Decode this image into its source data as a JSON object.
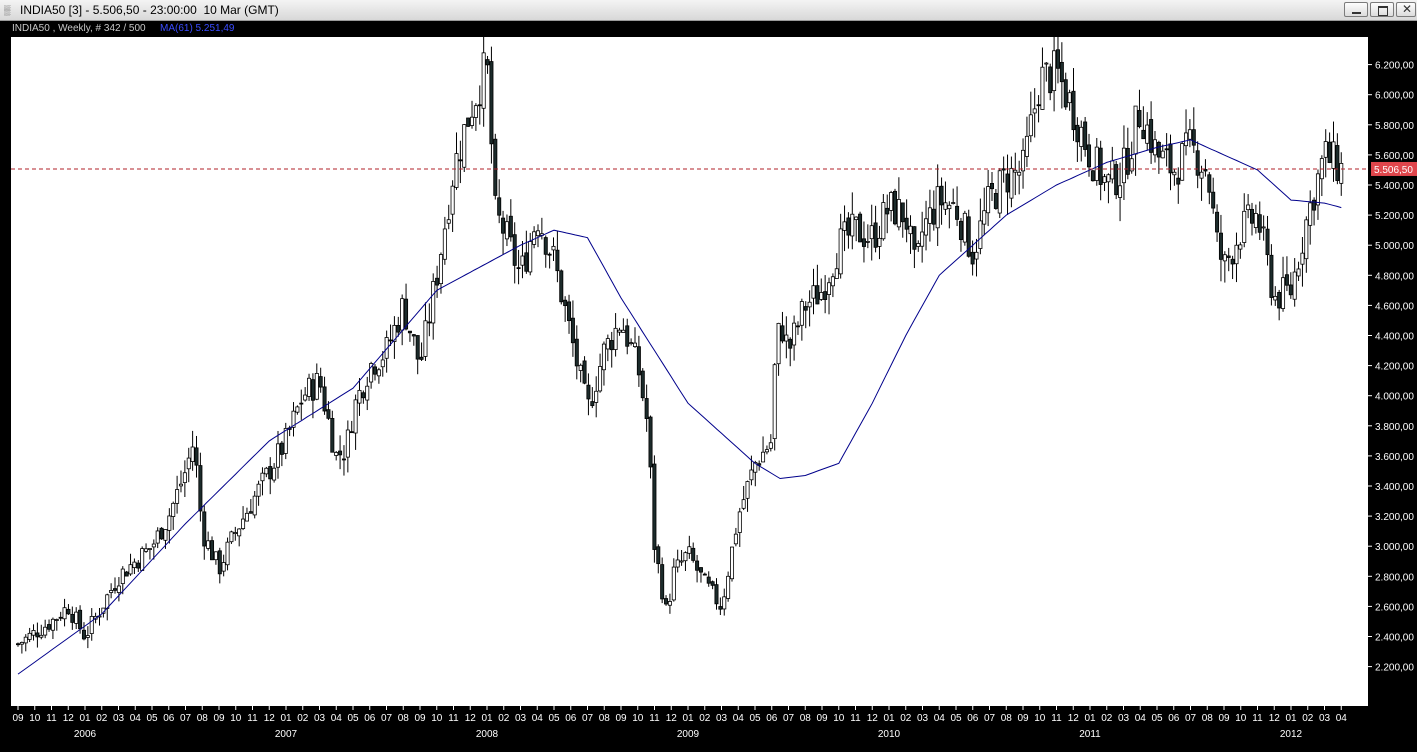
{
  "window": {
    "title": "INDIA50 [3] - 5.506,50 - 23:00:00  10 Mar (GMT)",
    "icon": "chart-icon",
    "buttons": [
      "minimize-icon",
      "maximize-icon",
      "close-icon"
    ]
  },
  "chart_data": {
    "type": "candlestick",
    "symbol_label": "INDIA50 , Weekly, # 342 / 500",
    "indicator_label": "MA(61) 5.251,49",
    "current_price_label": "5.506,50",
    "current_price": 5506.5,
    "ylim": [
      2100,
      6300
    ],
    "y_ticks": [
      2200,
      2400,
      2600,
      2800,
      3000,
      3200,
      3400,
      3600,
      3800,
      4000,
      4200,
      4400,
      4600,
      4800,
      5000,
      5200,
      5400,
      5600,
      5800,
      6000,
      6200
    ],
    "y_tick_labels": [
      "2.200,00",
      "2.400,00",
      "2.600,00",
      "2.800,00",
      "3.000,00",
      "3.200,00",
      "3.400,00",
      "3.600,00",
      "3.800,00",
      "4.000,00",
      "4.200,00",
      "4.400,00",
      "4.600,00",
      "4.800,00",
      "5.000,00",
      "5.200,00",
      "5.400,00",
      "5.600,00",
      "5.800,00",
      "6.000,00",
      "6.200,00"
    ],
    "x_month_labels": [
      "09",
      "10",
      "11",
      "12",
      "01",
      "02",
      "03",
      "04",
      "05",
      "06",
      "07",
      "08",
      "09",
      "10",
      "11",
      "12",
      "01",
      "02",
      "03",
      "04",
      "05",
      "06",
      "07",
      "08",
      "09",
      "10",
      "11",
      "12",
      "01",
      "02",
      "03",
      "04",
      "05",
      "06",
      "07",
      "08",
      "09",
      "10",
      "11",
      "12",
      "01",
      "02",
      "03",
      "04",
      "05",
      "06",
      "07",
      "08",
      "09",
      "10",
      "11",
      "12",
      "01",
      "02",
      "03",
      "04",
      "05",
      "06",
      "07",
      "08",
      "09",
      "10",
      "11",
      "12",
      "01",
      "02",
      "03",
      "04",
      "05",
      "06",
      "07",
      "08",
      "09",
      "10",
      "11",
      "12",
      "01",
      "02",
      "03",
      "04"
    ],
    "x_year_labels": [
      {
        "label": "2006",
        "month_index": 4
      },
      {
        "label": "2007",
        "month_index": 16
      },
      {
        "label": "2008",
        "month_index": 28
      },
      {
        "label": "2009",
        "month_index": 40
      },
      {
        "label": "2010",
        "month_index": 52
      },
      {
        "label": "2011",
        "month_index": 64
      },
      {
        "label": "2012",
        "month_index": 76
      }
    ],
    "price_path": [
      [
        0,
        2350
      ],
      [
        2,
        2500
      ],
      [
        3,
        2600
      ],
      [
        4,
        2400
      ],
      [
        5,
        2600
      ],
      [
        6,
        2800
      ],
      [
        7,
        2900
      ],
      [
        8,
        3000
      ],
      [
        9,
        3200
      ],
      [
        10,
        3500
      ],
      [
        10.5,
        3700
      ],
      [
        11,
        3100
      ],
      [
        12,
        2850
      ],
      [
        13,
        3100
      ],
      [
        14,
        3300
      ],
      [
        15,
        3500
      ],
      [
        16,
        3700
      ],
      [
        17,
        4000
      ],
      [
        18,
        4100
      ],
      [
        19,
        3600
      ],
      [
        19.6,
        3650
      ],
      [
        20,
        3900
      ],
      [
        21,
        4200
      ],
      [
        22,
        4300
      ],
      [
        23,
        4600
      ],
      [
        24,
        4200
      ],
      [
        25,
        4800
      ],
      [
        26,
        5500
      ],
      [
        27,
        5900
      ],
      [
        28,
        6200
      ],
      [
        28.5,
        5200
      ],
      [
        29,
        5100
      ],
      [
        30,
        4800
      ],
      [
        31,
        5200
      ],
      [
        32,
        4900
      ],
      [
        33,
        4400
      ],
      [
        34,
        3900
      ],
      [
        35,
        4300
      ],
      [
        36,
        4500
      ],
      [
        37,
        4200
      ],
      [
        37.6,
        3800
      ],
      [
        38,
        3000
      ],
      [
        38.8,
        2500
      ],
      [
        39,
        2800
      ],
      [
        40,
        2950
      ],
      [
        41,
        2750
      ],
      [
        42,
        2600
      ],
      [
        43,
        3200
      ],
      [
        44,
        3550
      ],
      [
        45,
        3700
      ],
      [
        45.1,
        4100
      ],
      [
        45.5,
        4500
      ],
      [
        46,
        4300
      ],
      [
        47,
        4600
      ],
      [
        48,
        4700
      ],
      [
        49,
        5000
      ],
      [
        50,
        5100
      ],
      [
        51,
        5050
      ],
      [
        52,
        5250
      ],
      [
        53,
        5200
      ],
      [
        53.6,
        4800
      ],
      [
        54,
        5100
      ],
      [
        55,
        5300
      ],
      [
        56,
        5250
      ],
      [
        57,
        4950
      ],
      [
        58,
        5300
      ],
      [
        59,
        5450
      ],
      [
        60,
        5500
      ],
      [
        61,
        6100
      ],
      [
        62,
        6150
      ],
      [
        63,
        5900
      ],
      [
        64,
        5600
      ],
      [
        65,
        5400
      ],
      [
        66,
        5500
      ],
      [
        67,
        5900
      ],
      [
        68,
        5600
      ],
      [
        69,
        5500
      ],
      [
        70,
        5650
      ],
      [
        71,
        5500
      ],
      [
        71.6,
        5000
      ],
      [
        72,
        4850
      ],
      [
        73,
        5100
      ],
      [
        74,
        5200
      ],
      [
        75,
        4650
      ],
      [
        76,
        4700
      ],
      [
        77,
        5200
      ],
      [
        78,
        5600
      ],
      [
        79,
        5506
      ]
    ],
    "ma_path": [
      [
        0,
        2150
      ],
      [
        5,
        2550
      ],
      [
        10,
        3150
      ],
      [
        15,
        3700
      ],
      [
        20,
        4050
      ],
      [
        25,
        4700
      ],
      [
        30,
        5000
      ],
      [
        32,
        5100
      ],
      [
        34,
        5050
      ],
      [
        36,
        4650
      ],
      [
        40,
        3950
      ],
      [
        44,
        3550
      ],
      [
        45.5,
        3450
      ],
      [
        47,
        3470
      ],
      [
        49,
        3550
      ],
      [
        51,
        3950
      ],
      [
        53,
        4400
      ],
      [
        55,
        4800
      ],
      [
        57,
        5000
      ],
      [
        59,
        5200
      ],
      [
        62,
        5400
      ],
      [
        65,
        5550
      ],
      [
        68,
        5650
      ],
      [
        70,
        5700
      ],
      [
        72,
        5600
      ],
      [
        74,
        5500
      ],
      [
        76,
        5300
      ],
      [
        78,
        5280
      ],
      [
        79,
        5250
      ]
    ]
  },
  "colors": {
    "background": "#000000",
    "plot_area": "#ffffff",
    "candle_up": "#ffffff",
    "candle_down": "#1c2b2b",
    "wick": "#000000",
    "ma_line": "#00008b",
    "price_line": "#b0202a",
    "price_label_bg": "#e0464c",
    "axis_text": "#ffffff",
    "indicator_text": "#3a4cff"
  }
}
